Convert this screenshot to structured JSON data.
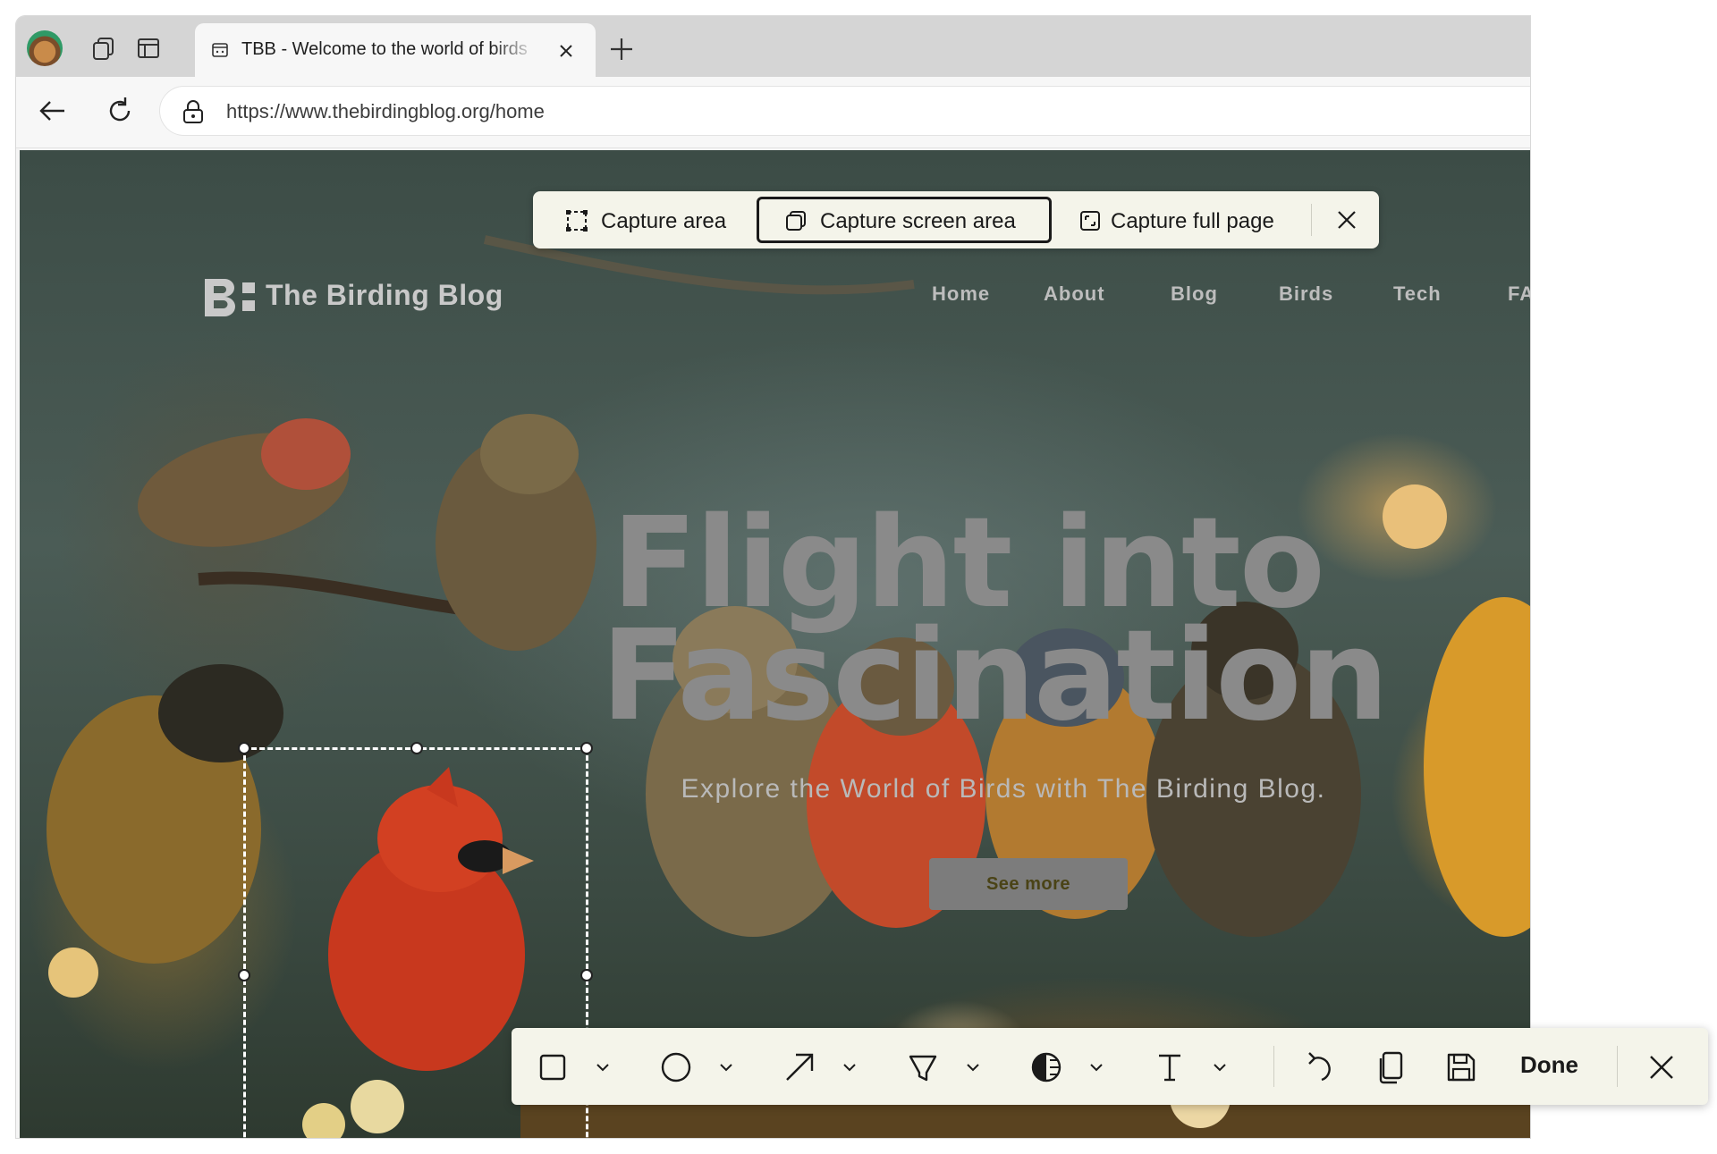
{
  "browser": {
    "tab_title": "TBB - Welcome to the world of birds",
    "url": "https://www.thebirdingblog.org/home"
  },
  "capture_toolbar": {
    "items": [
      {
        "label": "Capture area",
        "icon": "capture-area-icon",
        "active": false
      },
      {
        "label": "Capture screen area",
        "icon": "capture-screen-area-icon",
        "active": true
      },
      {
        "label": "Capture full page",
        "icon": "capture-full-page-icon",
        "active": false
      }
    ],
    "close_icon": "close-icon"
  },
  "site": {
    "logo_text": "The Birding Blog",
    "nav": [
      "Home",
      "About",
      "Blog",
      "Birds",
      "Tech",
      "FA"
    ],
    "hero_title_line1": "Flight into",
    "hero_title_line2": "Fascination",
    "hero_subtitle": "Explore the World of Birds with The Birding Blog.",
    "cta_label": "See more"
  },
  "annotation_toolbar": {
    "tools": [
      "rectangle-icon",
      "ellipse-icon",
      "arrow-icon",
      "highlighter-icon",
      "blur-icon",
      "text-icon"
    ],
    "actions": [
      "undo-icon",
      "copy-icon",
      "save-icon"
    ],
    "done_label": "Done"
  },
  "colors": {
    "toolbar_bg": "#f4f4ea",
    "hero_text": "#8a8a8a",
    "tabstrip_bg": "#d5d5d5"
  }
}
